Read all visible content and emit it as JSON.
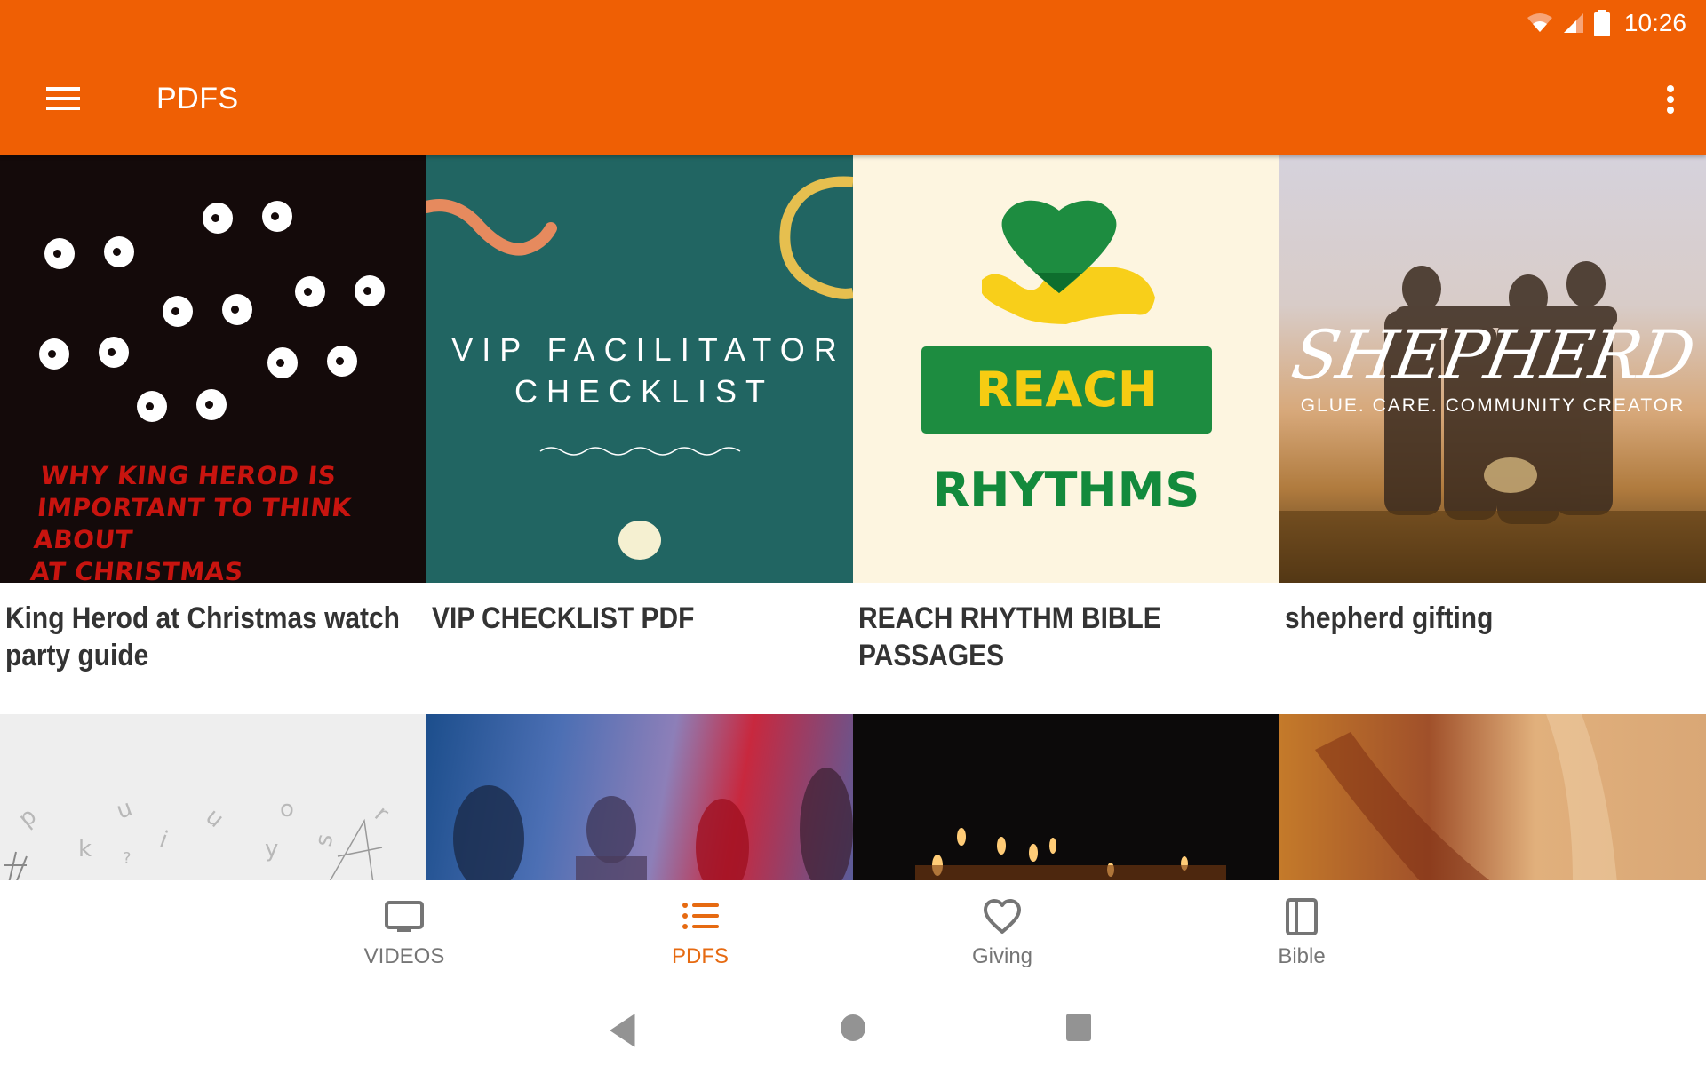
{
  "status_bar": {
    "time": "10:26",
    "icons": [
      "wifi-icon",
      "cell-signal-icon",
      "battery-icon"
    ]
  },
  "app_bar": {
    "title": "PDFS",
    "menu_icon": "hamburger-menu-icon",
    "overflow_icon": "more-vertical-icon",
    "color": "#ef5f04"
  },
  "pdfs": [
    {
      "title": "King Herod at Christmas watch party guide",
      "thumbnail_text": [
        "WHY KING HEROD IS",
        "IMPORTANT TO THINK ABOUT",
        "AT CHRISTMAS"
      ]
    },
    {
      "title": "VIP CHECKLIST PDF",
      "thumbnail_text": [
        "VIP FACILITATOR",
        "CHECKLIST"
      ]
    },
    {
      "title": "REACH RHYTHM BIBLE PASSAGES",
      "thumbnail_text": [
        "REACH",
        "RHYTHMS"
      ]
    },
    {
      "title": "shepherd gifting",
      "thumbnail_text": [
        "SHEPHERD",
        "GLUE. CARE. COMMUNITY CREATOR"
      ]
    }
  ],
  "pdfs_row2": [
    {
      "thumbnail": "letters"
    },
    {
      "thumbnail": "party"
    },
    {
      "thumbnail": "candles"
    },
    {
      "thumbnail": "abstract"
    }
  ],
  "bottom_nav": {
    "active": "PDFS",
    "active_color": "#e66a11",
    "items": [
      {
        "label": "VIDEOS",
        "icon": "tv-icon"
      },
      {
        "label": "PDFS",
        "icon": "list-icon"
      },
      {
        "label": "Giving",
        "icon": "heart-icon"
      },
      {
        "label": "Bible",
        "icon": "book-icon"
      }
    ]
  },
  "system_nav": [
    "back",
    "home",
    "recents"
  ]
}
